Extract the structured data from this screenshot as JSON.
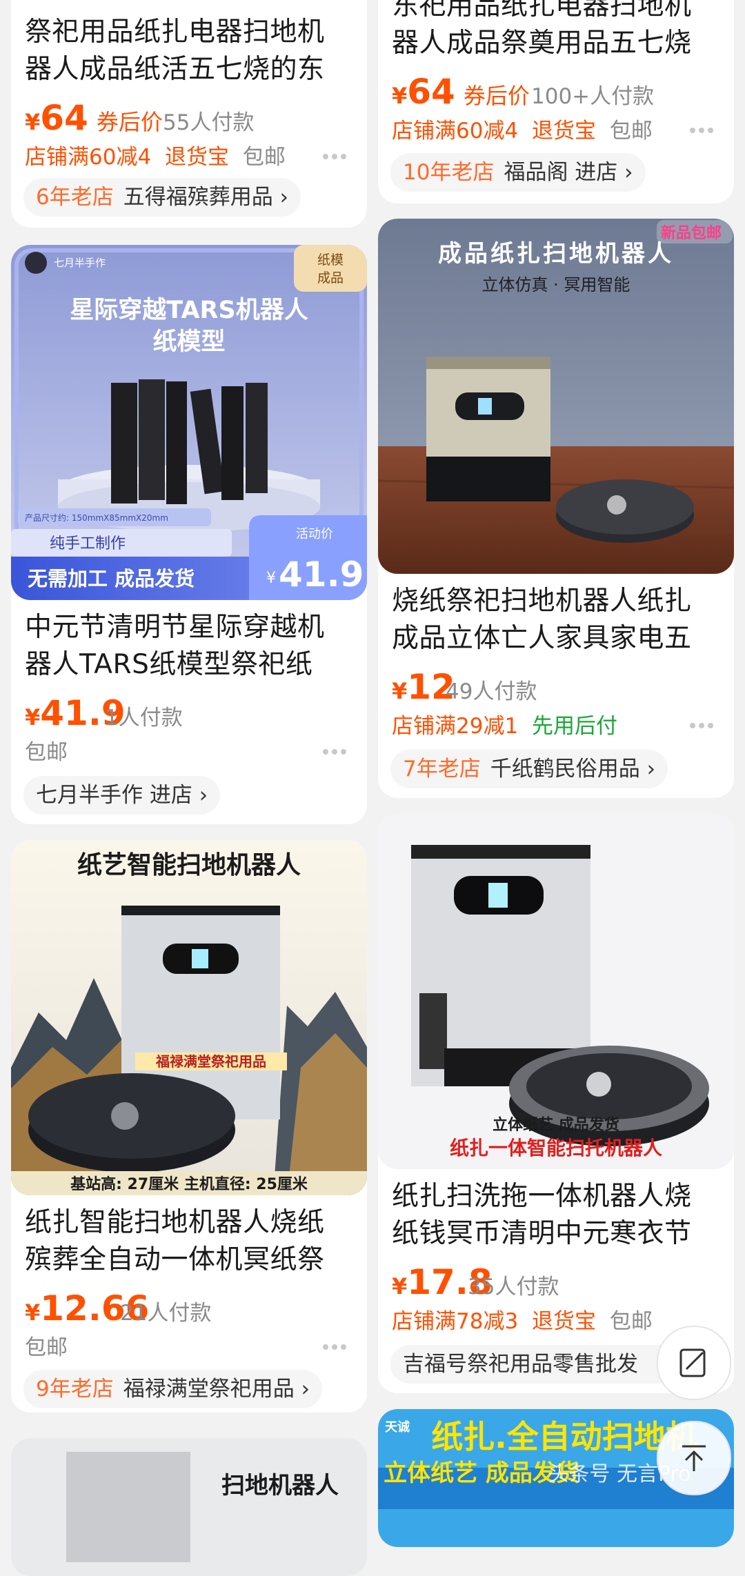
{
  "colors": {
    "price": "#ff5000",
    "green": "#19a837",
    "gray": "#8a8a8a"
  },
  "items": [
    {
      "title_l1": "祭祀用品纸扎电器扫地机",
      "title_l2": "器人成品纸活五七烧的东",
      "price_yen": "¥",
      "price": "64",
      "coupon": "券后价",
      "sold": "55人付款",
      "promo1": "店铺满60减4",
      "promo2": "退货宝",
      "promo3": "包邮",
      "shop_age": "6年老店",
      "shop_name": "五得福殡葬用品"
    },
    {
      "title_l1": "东祀用品纸扎电器扫地机",
      "title_l2": "器人成品祭奠用品五七烧",
      "price_yen": "¥",
      "price": "64",
      "coupon": "券后价",
      "sold": "100+人付款",
      "promo1": "店铺满60减4",
      "promo2": "退货宝",
      "promo3": "包邮",
      "shop_age": "10年老店",
      "shop_name": "福品阁 进店"
    },
    {
      "img": {
        "brand": "七月半手作",
        "corner": "纸模",
        "corner2": "成品",
        "headline1": "星际穿越TARS机器人",
        "headline2": "纸模型",
        "size": "产品尺寸约: 150mmX85mmX20mm",
        "handmade": "纯手工制作",
        "noneed": "无需加工 成品发货",
        "event": "活动价",
        "event_price": "41.9",
        "event_yen": "¥"
      },
      "title_l1": "中元节清明节星际穿越机",
      "title_l2": "器人TARS纸模型祭祀纸",
      "price_yen": "¥",
      "price": "41.9",
      "sold": "1人付款",
      "promo1": "包邮",
      "shop_name": "七月半手作 进店"
    },
    {
      "img": {
        "badge": "新品包邮",
        "headline": "成品纸扎扫地机器人",
        "sub": "立体仿真 · 冥用智能"
      },
      "title_l1": "烧纸祭祀扫地机器人纸扎",
      "title_l2": "成品立体亡人家具家电五",
      "price_yen": "¥",
      "price": "12",
      "sold": "49人付款",
      "promo1": "店铺满29减1",
      "promo2": "先用后付",
      "shop_age": "7年老店",
      "shop_name": "千纸鹤民俗用品"
    },
    {
      "img": {
        "headline": "纸艺智能扫地机器人",
        "store_label": "福禄满堂祭祀用品",
        "dims": "基站高: 27厘米 主机直径: 25厘米"
      },
      "title_l1": "纸扎智能扫地机器人烧纸",
      "title_l2": "殡葬全自动一体机冥纸祭",
      "price_yen": "¥",
      "price": "12.66",
      "sold": "21人付款",
      "promo1": "包邮",
      "shop_age": "9年老店",
      "shop_name": "福禄满堂祭祀用品"
    },
    {
      "img": {
        "line1": "立体纸艺 成品发货",
        "line2": "纸扎一体智能扫托机器人"
      },
      "title_l1": "纸扎扫洗拖一体机器人烧",
      "title_l2": "纸钱冥币清明中元寒衣节",
      "price_yen": "¥",
      "price": "17.8",
      "sold": "35人付款",
      "promo1": "店铺满78减3",
      "promo2": "退货宝",
      "promo3": "包邮",
      "shop_name": "吉福号祭祀用品零售批发"
    },
    {
      "img": {
        "headline": "扫地机器人"
      }
    },
    {
      "img": {
        "brand": "天诚",
        "headline": "纸扎.全自动扫地机",
        "sub": "立体纸艺  成品发货",
        "watermark": "头条号 无言Pro"
      }
    }
  ]
}
